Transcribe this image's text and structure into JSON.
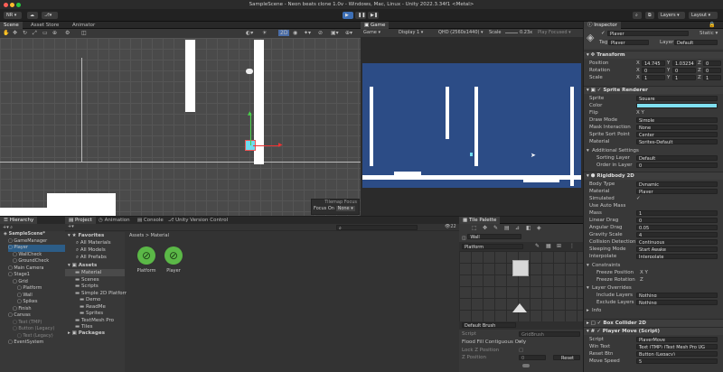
{
  "window": {
    "title": "SampleScene - Neon beats clone 1.0v - Windows, Mac, Linux - Unity 2022.3.34f1 <Metal>"
  },
  "toolbar": {
    "account": "NR",
    "layers": "Layers",
    "layout": "Layout"
  },
  "scene_tabs": [
    "Scene",
    "Asset Store",
    "Animator"
  ],
  "scene_overlay": {
    "title": "Tilemap Focus",
    "focus_label": "Focus On",
    "focus_value": "None"
  },
  "game": {
    "tab": "Game",
    "mode": "Game",
    "display": "Display 1",
    "resolution": "QHD (2560x1440)",
    "scale_label": "Scale",
    "scale_value": "0.23x",
    "play_focused": "Play Focused"
  },
  "bottom_tabs": [
    "Hierarchy",
    "Project",
    "Animation",
    "Console",
    "Unity Version Control"
  ],
  "hierarchy": {
    "items": [
      "SampleScene*",
      "GameManager",
      "Player",
      "WallCheck",
      "GroundCheck",
      "Main Camera",
      "Stage1",
      "Grid",
      "Platform",
      "Wall",
      "Spikes",
      "Finish",
      "Canvas",
      "Text (TMP)",
      "Button (Legacy)",
      "Text (Legacy)",
      "EventSystem"
    ]
  },
  "project": {
    "fav_header": "Favorites",
    "favorites": [
      "All Materials",
      "All Models",
      "All Prefabs"
    ],
    "assets_header": "Assets",
    "folders": [
      "Material",
      "Scenes",
      "Scripts",
      "Simple 2D Platformer",
      "Demo",
      "ReadMe",
      "Sprites",
      "TextMesh Pro",
      "Tiles"
    ],
    "packages": "Packages",
    "breadcrumb": "Assets > Material",
    "files": [
      "Platform",
      "Player"
    ],
    "count": "22"
  },
  "tile_palette": {
    "tab": "Tile Palette",
    "target": "Wall",
    "palette": "Platform",
    "brush": "Default Brush",
    "script_label": "Script",
    "script_value": "GridBrush",
    "flood_label": "Flood Fill Contiguous Only",
    "lock_label": "Lock Z Position",
    "zpos_label": "Z Position",
    "zpos_value": "0",
    "reset": "Reset"
  },
  "inspector": {
    "tab": "Inspector",
    "name": "Player",
    "static": "Static",
    "tag_label": "Tag",
    "tag": "Player",
    "layer_label": "Layer",
    "layer": "Default",
    "transform": {
      "title": "Transform",
      "rows": [
        {
          "label": "Position",
          "x": "14.745",
          "y": "1.03234",
          "z": "0"
        },
        {
          "label": "Rotation",
          "x": "0",
          "y": "0",
          "z": "0"
        },
        {
          "label": "Scale",
          "x": "1",
          "y": "1",
          "z": "1"
        }
      ]
    },
    "sprite_renderer": {
      "title": "Sprite Renderer",
      "rows": [
        {
          "label": "Sprite",
          "value": "Square"
        },
        {
          "label": "Color",
          "value": ""
        },
        {
          "label": "Flip",
          "value": "X   Y"
        },
        {
          "label": "Draw Mode",
          "value": "Simple"
        },
        {
          "label": "Mask Interaction",
          "value": "None"
        },
        {
          "label": "Sprite Sort Point",
          "value": "Center"
        },
        {
          "label": "Material",
          "value": "Sprites-Default"
        }
      ],
      "additional": "Additional Settings",
      "sorting_layer_label": "Sorting Layer",
      "sorting_layer": "Default",
      "order_label": "Order in Layer",
      "order": "0",
      "color": "#7fdff0"
    },
    "rigidbody": {
      "title": "Rigidbody 2D",
      "rows": [
        {
          "label": "Body Type",
          "value": "Dynamic"
        },
        {
          "label": "Material",
          "value": "Player"
        },
        {
          "label": "Simulated",
          "value": "✓"
        },
        {
          "label": "Use Auto Mass",
          "value": ""
        },
        {
          "label": "Mass",
          "value": "1"
        },
        {
          "label": "Linear Drag",
          "value": "0"
        },
        {
          "label": "Angular Drag",
          "value": "0.05"
        },
        {
          "label": "Gravity Scale",
          "value": "4"
        },
        {
          "label": "Collision Detection",
          "value": "Continuous"
        },
        {
          "label": "Sleeping Mode",
          "value": "Start Awake"
        },
        {
          "label": "Interpolate",
          "value": "Interpolate"
        }
      ],
      "constraints": "Constraints",
      "freeze_pos": "Freeze Position",
      "freeze_pos_val": "X   Y",
      "freeze_rot": "Freeze Rotation",
      "freeze_rot_val": "Z",
      "overrides": "Layer Overrides",
      "include": "Include Layers",
      "include_val": "Nothing",
      "exclude": "Exclude Layers",
      "exclude_val": "Nothing",
      "info": "Info"
    },
    "box_collider": {
      "title": "Box Collider 2D"
    },
    "player_move": {
      "title": "Player Move (Script)",
      "rows": [
        {
          "label": "Script",
          "value": "PlayerMove"
        },
        {
          "label": "Win Text",
          "value": "Text (TMP) (Text Mesh Pro UG"
        },
        {
          "label": "Reset Btn",
          "value": "Button (Legacy)"
        },
        {
          "label": "Move Speed",
          "value": "5"
        }
      ]
    }
  }
}
